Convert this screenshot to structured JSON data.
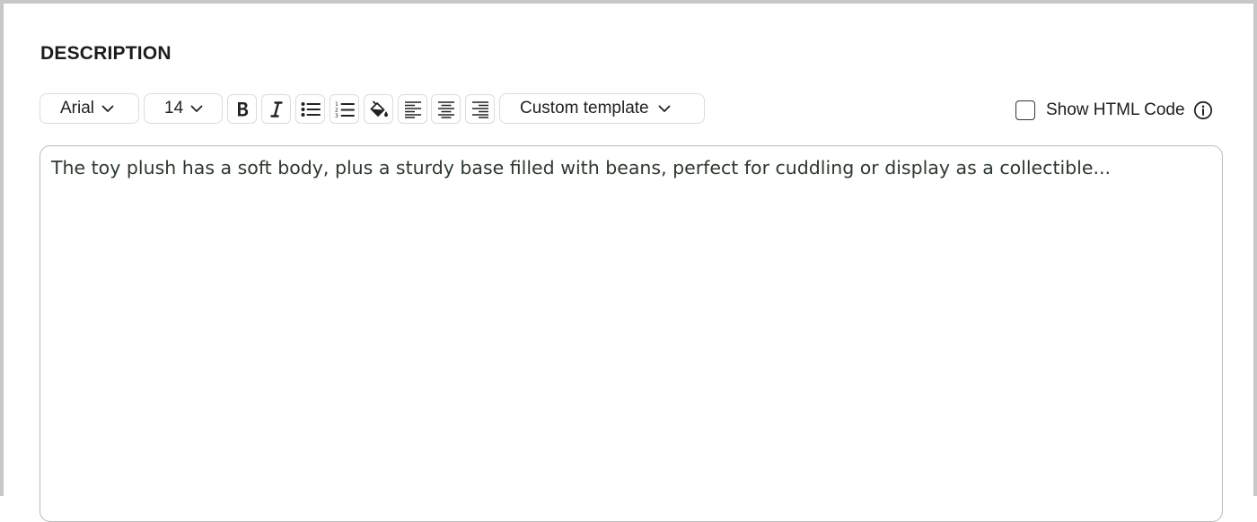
{
  "section": {
    "title": "DESCRIPTION"
  },
  "toolbar": {
    "font_family": "Arial",
    "font_size": "14",
    "template": "Custom template",
    "buttons": [
      "bold-icon",
      "italic-icon",
      "bulleted-list-icon",
      "numbered-list-icon",
      "paint-bucket-icon",
      "align-left-icon",
      "align-center-icon",
      "align-right-icon"
    ],
    "show_html": {
      "label": "Show HTML Code",
      "checked": false
    }
  },
  "editor": {
    "text": "The toy plush has a soft body, plus a sturdy base filled with beans, perfect for cuddling or display as a collectible..."
  }
}
